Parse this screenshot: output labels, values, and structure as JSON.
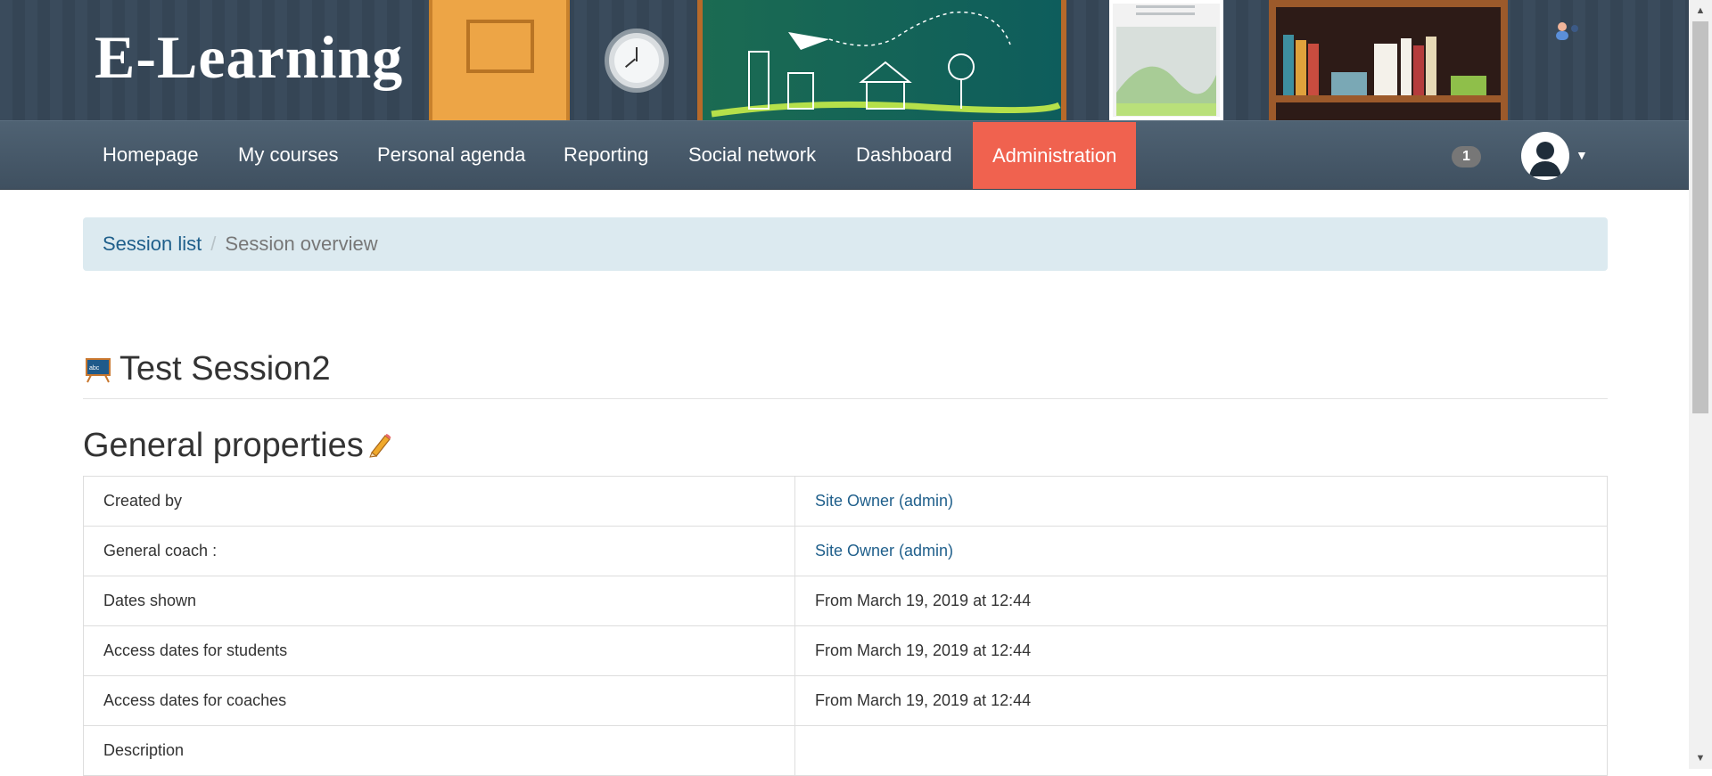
{
  "site": {
    "logo_text": "E-Learning"
  },
  "navbar": {
    "items": [
      {
        "label": "Homepage"
      },
      {
        "label": "My courses"
      },
      {
        "label": "Personal agenda"
      },
      {
        "label": "Reporting"
      },
      {
        "label": "Social network"
      },
      {
        "label": "Dashboard"
      },
      {
        "label": "Administration",
        "active": true
      }
    ],
    "notification_count": "1",
    "accent_color": "#f0624f"
  },
  "breadcrumb": {
    "items": [
      "Session list",
      "Session overview"
    ]
  },
  "session": {
    "title": "Test Session2"
  },
  "general_properties": {
    "heading": "General properties",
    "rows": [
      {
        "label": "Created by",
        "value": "Site Owner (admin)",
        "is_link": true
      },
      {
        "label": "General coach :",
        "value": "Site Owner (admin)",
        "is_link": true
      },
      {
        "label": "Dates shown",
        "value": "From March 19, 2019 at 12:44"
      },
      {
        "label": "Access dates for students",
        "value": "From March 19, 2019 at 12:44"
      },
      {
        "label": "Access dates for coaches",
        "value": "From March 19, 2019 at 12:44"
      },
      {
        "label": "Description",
        "value": ""
      }
    ]
  },
  "icons": {
    "session": "session-blackboard-icon",
    "edit": "pencil-edit-icon",
    "avatar": "user-avatar-icon",
    "caret": "caret-down-icon"
  }
}
